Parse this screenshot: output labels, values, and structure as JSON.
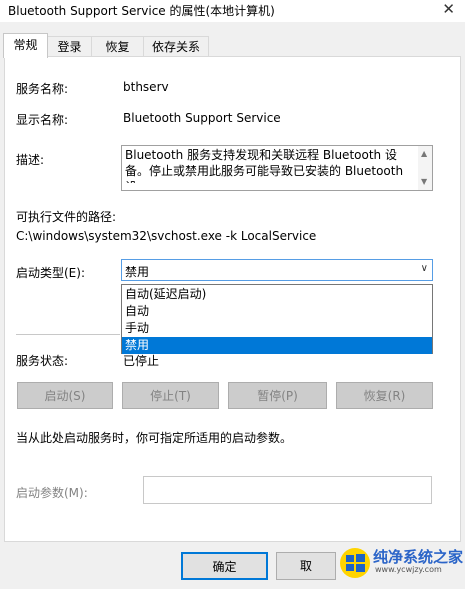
{
  "window": {
    "title": "Bluetooth Support Service 的属性(本地计算机)",
    "close_glyph": "✕"
  },
  "tabs": [
    "常规",
    "登录",
    "恢复",
    "依存关系"
  ],
  "general": {
    "service_name_label": "服务名称:",
    "service_name": "bthserv",
    "display_name_label": "显示名称:",
    "display_name": "Bluetooth Support Service",
    "description_label": "描述:",
    "description": "Bluetooth 服务支持发现和关联远程 Bluetooth 设备。停止或禁用此服务可能导致已安装的 Bluetooth 设",
    "exe_path_label": "可执行文件的路径:",
    "exe_path": "C:\\windows\\system32\\svchost.exe -k LocalService",
    "startup_type_label": "启动类型(E):",
    "startup_type_value": "禁用",
    "startup_options": [
      "自动(延迟启动)",
      "自动",
      "手动",
      "禁用"
    ],
    "selected_option_index": 3,
    "status_label": "服务状态:",
    "status_value": "已停止",
    "buttons": {
      "start": "启动(S)",
      "stop": "停止(T)",
      "pause": "暂停(P)",
      "resume": "恢复(R)"
    },
    "hint": "当从此处启动服务时，你可指定所适用的启动参数。",
    "params_label": "启动参数(M):",
    "params_value": ""
  },
  "footer": {
    "ok": "确定",
    "cancel": "取"
  },
  "watermark": {
    "text": "纯净系统之家",
    "url": "www.ycwjzy.com"
  }
}
